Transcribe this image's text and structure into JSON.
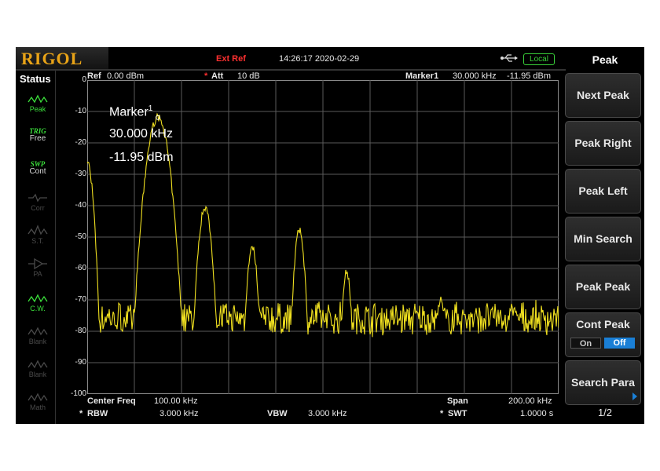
{
  "header": {
    "logo": "RIGOL",
    "ext_ref": "Ext Ref",
    "datetime": "14:26:17 2020-02-29",
    "usb_icon": "usb-icon",
    "local": "Local"
  },
  "status": {
    "title": "Status",
    "items": [
      {
        "label": "Peak",
        "state": "on",
        "icon": "peak-wave-icon"
      },
      {
        "label": "TRIG",
        "label2": "Free",
        "state": "on"
      },
      {
        "label": "SWP",
        "label2": "Cont",
        "state": "on"
      },
      {
        "label": "Corr",
        "state": "off",
        "icon": "corr-wave-icon"
      },
      {
        "label": "S.T.",
        "state": "off",
        "icon": "st-wave-icon"
      },
      {
        "label": "PA",
        "state": "off",
        "icon": "pa-icon"
      },
      {
        "label": "C.W.",
        "state": "on",
        "icon": "cw-wave-icon"
      },
      {
        "label": "Blank",
        "state": "off",
        "icon": "blank-wave-icon"
      },
      {
        "label": "Blank",
        "state": "off",
        "icon": "blank-wave-icon"
      },
      {
        "label": "Math",
        "state": "off",
        "icon": "math-wave-icon"
      }
    ]
  },
  "top_bar": {
    "ref_label": "Ref",
    "ref_value": "0.00 dBm",
    "att_star": "*",
    "att_label": "Att",
    "att_value": "10 dB",
    "marker_label": "Marker1",
    "marker_freq": "30.000 kHz",
    "marker_amp": "-11.95 dBm"
  },
  "marker_box": {
    "title": "Marker",
    "sup": "1",
    "freq": "30.000 kHz",
    "amp": "-11.95 dBm"
  },
  "bottom_bar": {
    "center_label": "Center Freq",
    "center_value": "100.00 kHz",
    "span_label": "Span",
    "span_value": "200.00 kHz",
    "rbw_star": "*",
    "rbw_label": "RBW",
    "rbw_value": "3.000 kHz",
    "vbw_label": "VBW",
    "vbw_value": "3.000 kHz",
    "swt_star": "*",
    "swt_label": "SWT",
    "swt_value": "1.0000 s"
  },
  "menu": {
    "title": "Peak",
    "buttons": [
      "Next Peak",
      "Peak Right",
      "Peak Left",
      "Min Search",
      "Peak Peak",
      "Cont Peak",
      "Search Para"
    ],
    "cont_on": "On",
    "cont_off": "Off",
    "page": "1/2"
  },
  "chart_data": {
    "type": "line",
    "y_tick_labels": [
      "0",
      "-10",
      "-20",
      "-30",
      "-40",
      "-50",
      "-60",
      "-70",
      "-80",
      "-90",
      "-100"
    ],
    "ylim": [
      -100,
      0
    ],
    "xlim": [
      0,
      200
    ],
    "x_unit": "kHz",
    "y_unit": "dBm",
    "grid": true,
    "trace_color": "#f0e020",
    "grid_color": "#5a5a5a",
    "noise_floor": -76,
    "peaks": [
      {
        "x": 0,
        "y": -26,
        "width": 1.8
      },
      {
        "x": 30,
        "y": -11.95,
        "width": 3.2
      },
      {
        "x": 50,
        "y": -40.5,
        "width": 2.0
      },
      {
        "x": 70,
        "y": -53,
        "width": 1.6
      },
      {
        "x": 90,
        "y": -48,
        "width": 1.6
      },
      {
        "x": 110,
        "y": -60.5,
        "width": 1.3
      },
      {
        "x": 150,
        "y": -70,
        "width": 1.2
      },
      {
        "x": 180,
        "y": -72,
        "width": 1.2
      }
    ],
    "marker": {
      "x": 30,
      "y": -11.95
    }
  }
}
